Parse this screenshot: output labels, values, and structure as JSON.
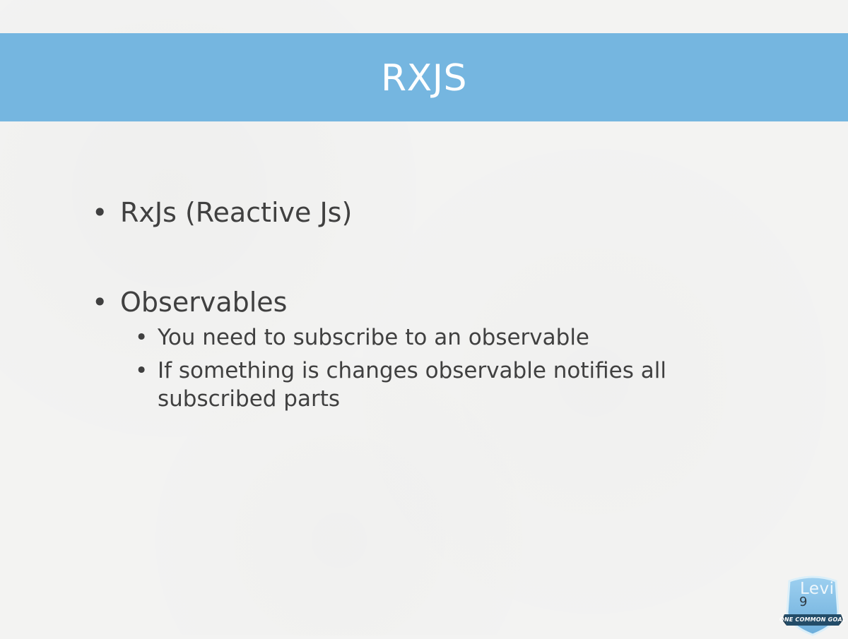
{
  "slide": {
    "title": "RXJS",
    "bullets": [
      {
        "text": "RxJs (Reactive Js)"
      },
      {
        "text": "Observables",
        "sub_bullets": [
          "You need to subscribe to an observable",
          "If something is changes observable notifies all subscribed parts"
        ]
      }
    ]
  },
  "logo": {
    "brand": "Levi",
    "number": "9",
    "tagline": "ONE COMMON GOAL",
    "icon": "levi9-shield-icon"
  },
  "colors": {
    "title_band": "#75b6e0",
    "title_text": "#ffffff",
    "body_text": "#404040",
    "background": "#f3f3f2",
    "logo_shield": "#8cc3e8",
    "logo_banner": "#234c68"
  }
}
